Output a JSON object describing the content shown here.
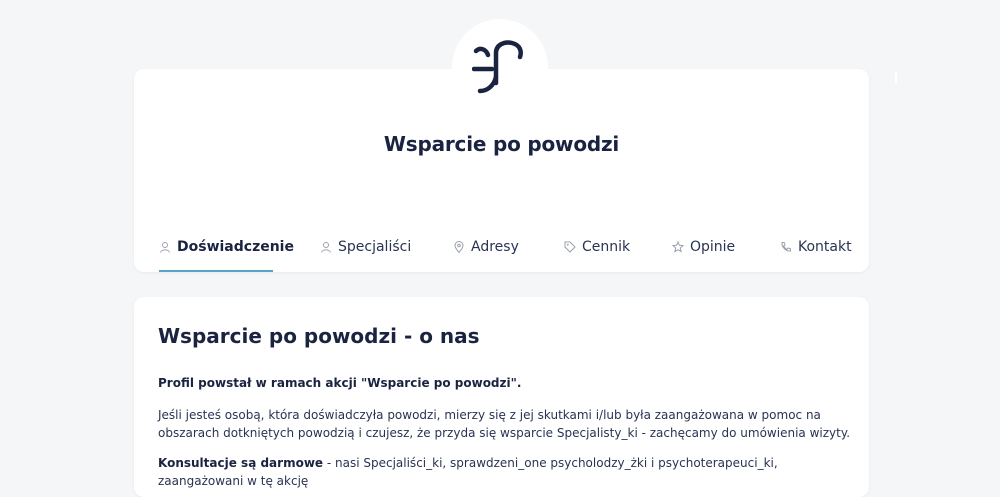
{
  "profile": {
    "name": "Wsparcie po powodzi",
    "logo_icon": "brand-logo-icon"
  },
  "tabs": [
    {
      "label": "Doświadczenie",
      "icon": "user-icon",
      "active": true
    },
    {
      "label": "Specjaliści",
      "icon": "user-icon",
      "active": false
    },
    {
      "label": "Adresy",
      "icon": "map-pin-icon",
      "active": false
    },
    {
      "label": "Cennik",
      "icon": "tag-icon",
      "active": false
    },
    {
      "label": "Opinie",
      "icon": "star-icon",
      "active": false
    },
    {
      "label": "Kontakt",
      "icon": "phone-icon",
      "active": false
    }
  ],
  "about": {
    "title": "Wsparcie po powodzi - o nas",
    "intro": "Profil powstał w ramach akcji \"Wsparcie po powodzi\".",
    "paragraph": "Jeśli jesteś osobą, która doświadczyła powodzi, mierzy się z jej skutkami i/lub była zaangażowana w pomoc na obszarach dotkniętych powodzią i czujesz, że przyda się wsparcie Specjalisty_ki - zachęcamy do umówienia wizyty.",
    "consult_bold": "Konsultacje są darmowe",
    "consult_rest": " - nasi Specjaliści_ki, sprawdzeni_one psycholodzy_żki i psychoterapeuci_ki, zaangażowani w tę akcję"
  },
  "colors": {
    "navy": "#1a2340",
    "accent": "#5aa3c9",
    "background": "#f5f6f8"
  }
}
